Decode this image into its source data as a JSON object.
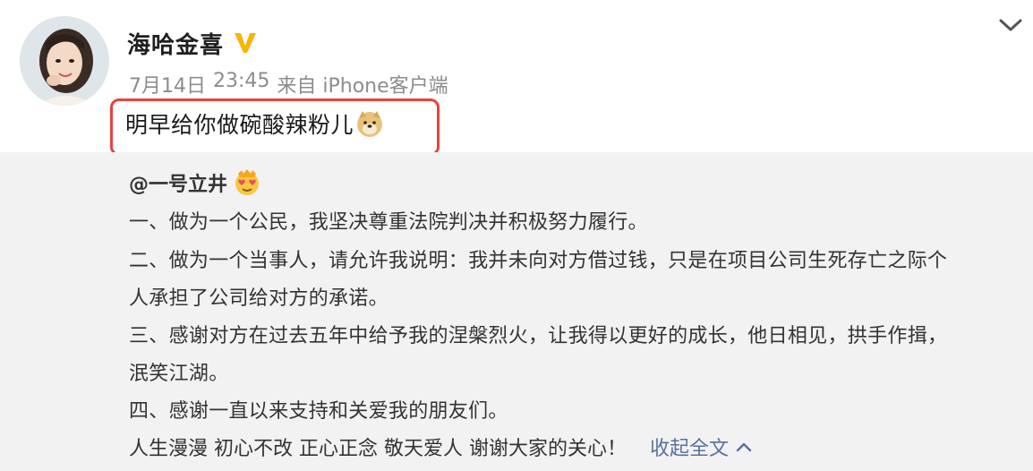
{
  "post": {
    "author": "海哈金喜",
    "date": "7月14日",
    "time": "23:45",
    "source": "来自 iPhone客户端",
    "text": "明早给你做碗酸辣粉儿",
    "emoji": "doge-emoji"
  },
  "repost": {
    "mention": "@一号立井",
    "mention_emoji": "heart-eyes-emoji",
    "lines": [
      "一、做为一个公民，我坚决尊重法院判决并积极努力履行。",
      "二、做为一个当事人，请允许我说明：我并未向对方借过钱，只是在项目公司生死存亡之际个",
      "人承担了公司给对方的承诺。",
      "三、感谢对方在过去五年中给予我的涅槃烈火，让我得以更好的成长，他日相见，拱手作揖，",
      "泯笑江湖。",
      "四、感谢一直以来支持和关爱我的朋友们。"
    ],
    "last_line": "人生漫漫 初心不改 正心正念 敬天爱人 谢谢大家的关心！",
    "collapse_label": "收起全文"
  },
  "colors": {
    "highlight_box": "#e8413e",
    "verified_badge": "#f5b700",
    "link": "#58729a",
    "repost_bg": "#f2f2f2"
  }
}
